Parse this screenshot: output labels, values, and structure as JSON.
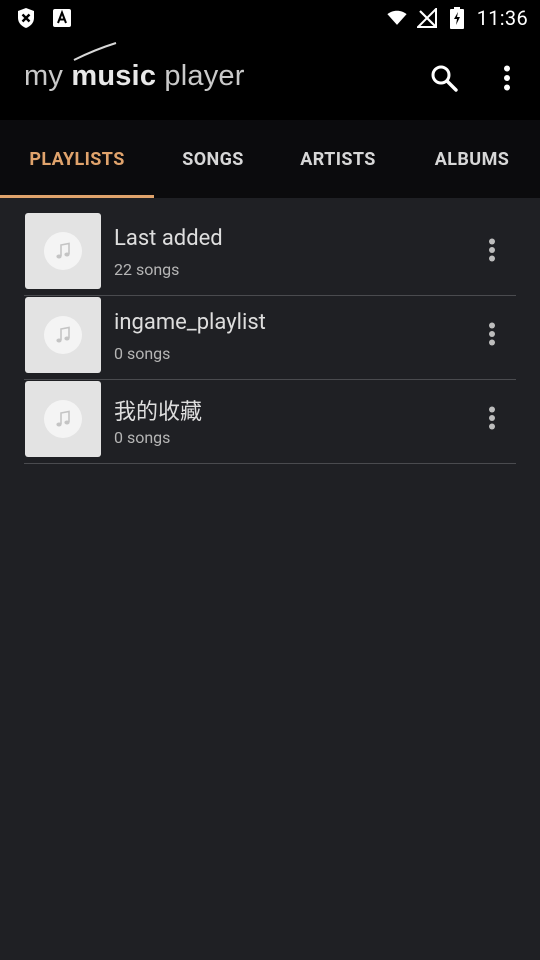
{
  "status_bar": {
    "time": "11:36",
    "icons": [
      "shield-notification-icon",
      "font-a-notification-icon",
      "wifi-icon",
      "no-signal-icon",
      "battery-charging-icon"
    ]
  },
  "app_bar": {
    "logo_text_prefix": "my",
    "logo_text_bold": "music",
    "logo_text_suffix": "player",
    "actions": [
      "search-icon",
      "more-vert-icon"
    ]
  },
  "tabs": [
    {
      "label": "PLAYLISTS",
      "active": true
    },
    {
      "label": "SONGS",
      "active": false
    },
    {
      "label": "ARTISTS",
      "active": false
    },
    {
      "label": "ALBUMS",
      "active": false
    }
  ],
  "playlists": [
    {
      "title": "Last added",
      "subtitle": "22 songs"
    },
    {
      "title": "ingame_playlist",
      "subtitle": "0 songs"
    },
    {
      "title": "我的收藏",
      "subtitle": "0 songs"
    }
  ],
  "colors": {
    "accent": "#e0a36c",
    "background": "#1f2024",
    "app_bar": "#000000",
    "tab_bar": "#0b0b0d"
  }
}
